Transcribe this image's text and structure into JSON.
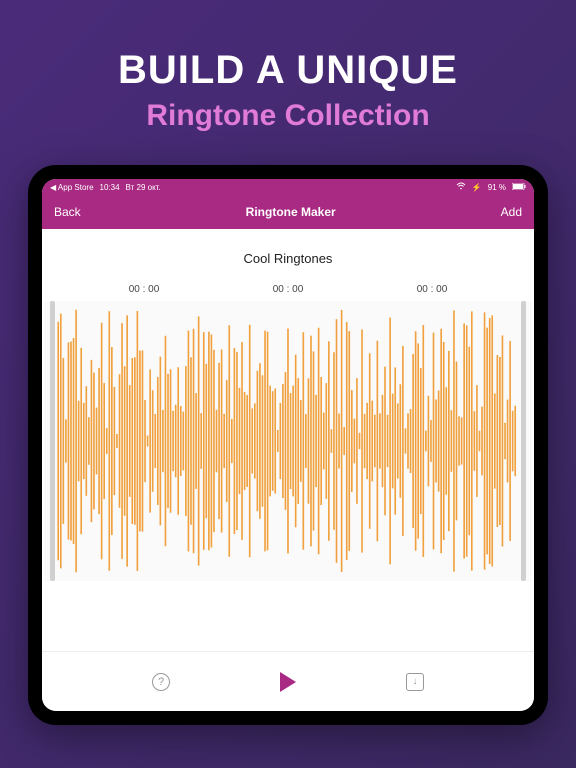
{
  "promo": {
    "line1": "BUILD A UNIQUE",
    "line2": "Ringtone Collection"
  },
  "statusbar": {
    "back_to_app": "◀ App Store",
    "time": "10:34",
    "date": "Вт 29 окт.",
    "wifi_icon": "wifi",
    "battery_text": "91 %",
    "charging_icon": "bolt"
  },
  "navbar": {
    "back_label": "Back",
    "title": "Ringtone Maker",
    "add_label": "Add"
  },
  "editor": {
    "track_title": "Cool Ringtones",
    "time_markers": [
      "00 : 00",
      "00 : 00",
      "00 : 00"
    ],
    "waveform_color": "#f0a03c"
  },
  "toolbar": {
    "help_icon": "?",
    "play_icon": "play",
    "export_icon": "export"
  },
  "colors": {
    "accent": "#a82a82",
    "promo_bg": "#3e2a68",
    "promo_subtitle": "#e07bd8"
  }
}
